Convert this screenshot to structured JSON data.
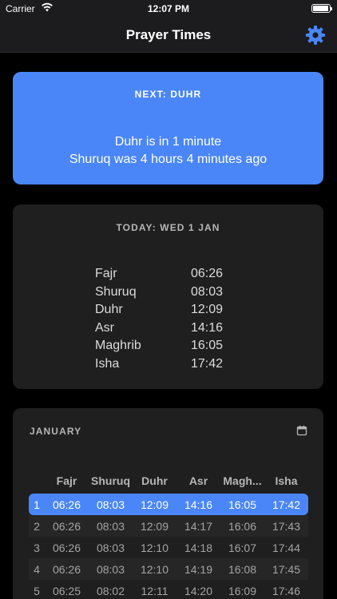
{
  "status_bar": {
    "carrier": "Carrier",
    "time": "12:07 PM"
  },
  "nav": {
    "title": "Prayer Times",
    "settings_icon": "gear-icon"
  },
  "next_card": {
    "heading": "NEXT: DUHR",
    "line1": "Duhr is in 1 minute",
    "line2": "Shuruq was 4 hours 4 minutes ago",
    "color": "#4a86f7"
  },
  "today_card": {
    "heading": "TODAY: WED 1 JAN",
    "times": [
      {
        "name": "Fajr",
        "time": "06:26"
      },
      {
        "name": "Shuruq",
        "time": "08:03"
      },
      {
        "name": "Duhr",
        "time": "12:09"
      },
      {
        "name": "Asr",
        "time": "14:16"
      },
      {
        "name": "Maghrib",
        "time": "16:05"
      },
      {
        "name": "Isha",
        "time": "17:42"
      }
    ]
  },
  "month_card": {
    "heading": "JANUARY",
    "calendar_icon": "calendar-icon",
    "columns": [
      "",
      "Fajr",
      "Shuruq",
      "Duhr",
      "Asr",
      "Magh...",
      "Isha"
    ],
    "rows": [
      [
        "1",
        "06:26",
        "08:03",
        "12:09",
        "14:16",
        "16:05",
        "17:42"
      ],
      [
        "2",
        "06:26",
        "08:03",
        "12:09",
        "14:17",
        "16:06",
        "17:43"
      ],
      [
        "3",
        "06:26",
        "08:03",
        "12:10",
        "14:18",
        "16:07",
        "17:44"
      ],
      [
        "4",
        "06:26",
        "08:03",
        "12:10",
        "14:19",
        "16:08",
        "17:45"
      ],
      [
        "5",
        "06:25",
        "08:02",
        "12:11",
        "14:20",
        "16:09",
        "17:46"
      ]
    ],
    "selected_row": 0
  }
}
